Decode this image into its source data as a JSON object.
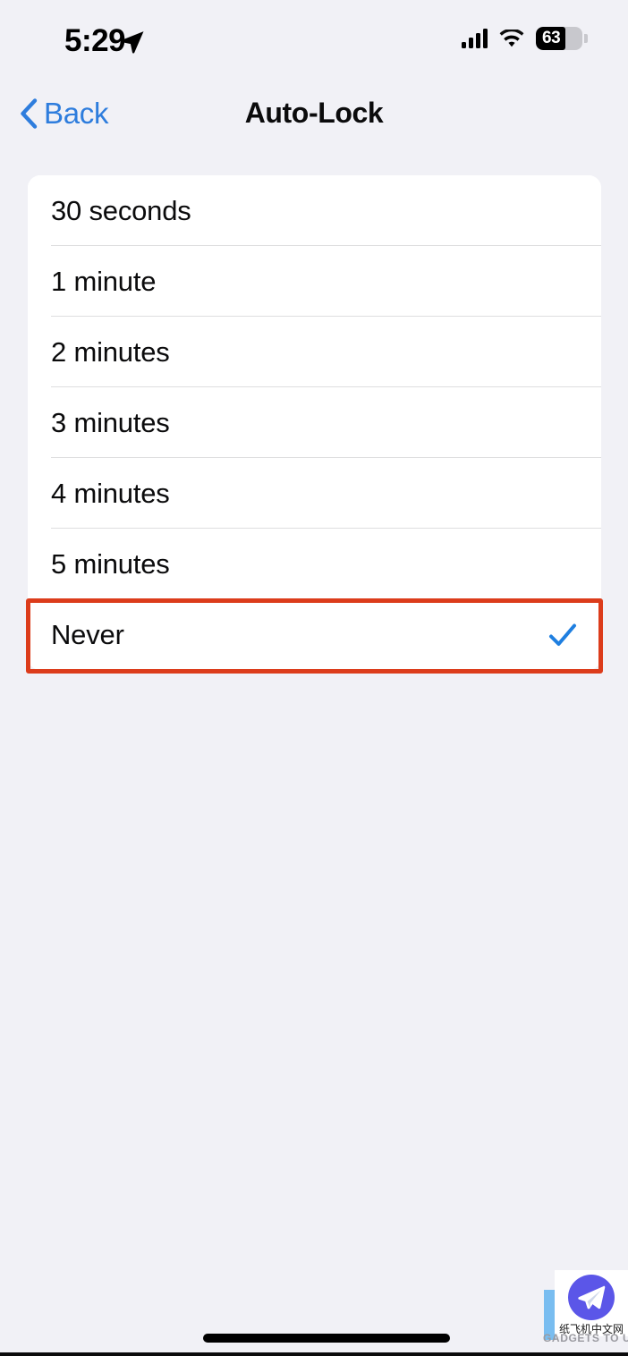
{
  "status_bar": {
    "time": "5:29",
    "location_icon": "location-arrow-icon",
    "cellular_icon": "cellular-signal-icon",
    "signal_bars": 4,
    "wifi_icon": "wifi-icon",
    "battery_percent": "63",
    "battery_level": 63
  },
  "nav": {
    "back_label": "Back",
    "back_icon": "chevron-left-icon",
    "title": "Auto-Lock"
  },
  "list": {
    "options": [
      {
        "label": "30 seconds",
        "selected": false
      },
      {
        "label": "1 minute",
        "selected": false
      },
      {
        "label": "2 minutes",
        "selected": false
      },
      {
        "label": "3 minutes",
        "selected": false
      },
      {
        "label": "4 minutes",
        "selected": false
      },
      {
        "label": "5 minutes",
        "selected": false
      },
      {
        "label": "Never",
        "selected": true
      }
    ],
    "selected_value": "Never",
    "checkmark_icon": "checkmark-icon"
  },
  "annotation": {
    "target": "Never",
    "color": "#dc3c1b"
  },
  "watermark": {
    "logo_icon": "paper-plane-icon",
    "chinese_text": "纸飞机中文网",
    "brand_text": "GADGETS TO USE"
  },
  "colors": {
    "background": "#f1f1f6",
    "card": "#ffffff",
    "accent_blue": "#2e7ddd",
    "checkmark_blue": "#1f7fe0",
    "annotation_red": "#dc3c1b",
    "separator": "#dededf",
    "text_primary": "#0b0b0c"
  },
  "home_indicator": "home-indicator"
}
